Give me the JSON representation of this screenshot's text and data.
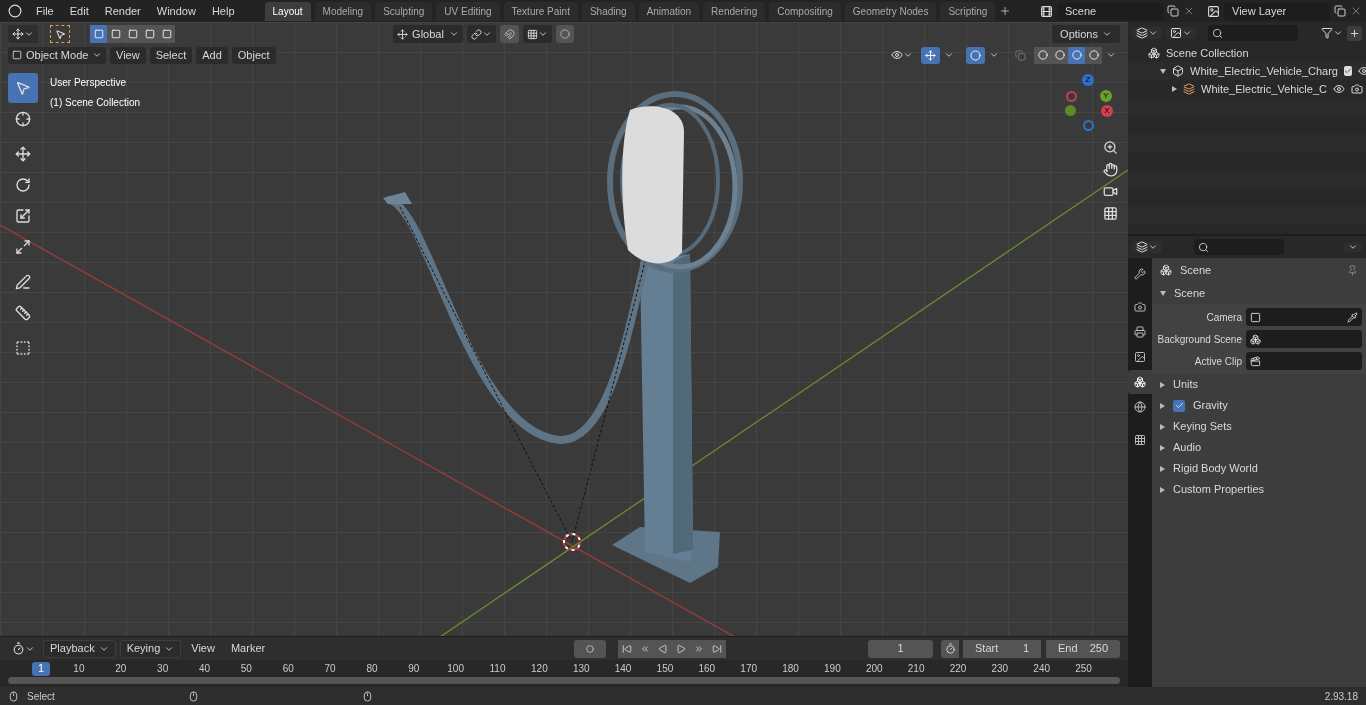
{
  "menu_bar": {
    "menus": [
      "File",
      "Edit",
      "Render",
      "Window",
      "Help"
    ],
    "workspaces": [
      {
        "label": "Layout",
        "selected": true
      },
      {
        "label": "Modeling",
        "selected": false
      },
      {
        "label": "Sculpting",
        "selected": false
      },
      {
        "label": "UV Editing",
        "selected": false
      },
      {
        "label": "Texture Paint",
        "selected": false
      },
      {
        "label": "Shading",
        "selected": false
      },
      {
        "label": "Animation",
        "selected": false
      },
      {
        "label": "Rendering",
        "selected": false
      },
      {
        "label": "Compositing",
        "selected": false
      },
      {
        "label": "Geometry Nodes",
        "selected": false
      },
      {
        "label": "Scripting",
        "selected": false
      }
    ],
    "scene": "Scene",
    "view_layer": "View Layer"
  },
  "viewport": {
    "select_modes": [
      {
        "selected": true
      },
      {
        "selected": false
      },
      {
        "selected": false
      },
      {
        "selected": false
      },
      {
        "selected": false
      }
    ],
    "orientation": "Global",
    "options": "Options",
    "mode": "Object Mode",
    "menus": [
      "View",
      "Select",
      "Add",
      "Object"
    ],
    "shading": [
      {
        "selected": false
      },
      {
        "selected": false
      },
      {
        "selected": true
      },
      {
        "selected": false
      }
    ],
    "overlay_text": [
      "User Perspective",
      "(1) Scene Collection"
    ],
    "tools": [
      {
        "selected": true
      },
      {
        "selected": false
      },
      {
        "selected": false
      },
      {
        "selected": false
      },
      {
        "selected": false
      },
      {
        "selected": false
      },
      {
        "selected": false
      },
      {
        "selected": false
      },
      {
        "selected": false
      }
    ],
    "gizmo_axes": [
      "Z",
      "Y",
      "X"
    ]
  },
  "outliner": {
    "items": [
      {
        "label": "Scene Collection",
        "kind": "scene",
        "children": [
          {
            "label": "White_Electric_Vehicle_Charg",
            "kind": "collection",
            "expanded": true,
            "checked": true,
            "children": [
              {
                "label": "White_Electric_Vehicle_C",
                "kind": "empty",
                "expanded": false
              }
            ]
          }
        ]
      }
    ]
  },
  "properties": {
    "tabs": [
      {
        "selected": false
      },
      {
        "selected": false
      },
      {
        "selected": false
      },
      {
        "selected": false
      },
      {
        "selected": true
      },
      {
        "selected": false
      },
      {
        "selected": false
      }
    ],
    "context": "Scene",
    "panel": {
      "title": "Scene",
      "expanded": true,
      "fields": [
        {
          "label": "Camera",
          "kind": "camera"
        },
        {
          "label": "Background Scene",
          "kind": "scene"
        },
        {
          "label": "Active Clip",
          "kind": "clip"
        }
      ]
    },
    "sections": [
      {
        "label": "Units",
        "expanded": false
      },
      {
        "label": "Gravity",
        "expanded": false,
        "checked": true
      },
      {
        "label": "Keying Sets",
        "expanded": false
      },
      {
        "label": "Audio",
        "expanded": false
      },
      {
        "label": "Rigid Body World",
        "expanded": false
      },
      {
        "label": "Custom Properties",
        "expanded": false
      }
    ]
  },
  "timeline": {
    "menus": [
      "Playback",
      "Keying",
      "View",
      "Marker"
    ],
    "current_frame": "1",
    "start_label": "Start",
    "start": "1",
    "end_label": "End",
    "end": "250",
    "playhead": "1",
    "ticks": [
      "10",
      "20",
      "30",
      "40",
      "50",
      "60",
      "70",
      "80",
      "90",
      "100",
      "110",
      "120",
      "130",
      "140",
      "150",
      "160",
      "170",
      "180",
      "190",
      "200",
      "210",
      "220",
      "230",
      "240",
      "250"
    ]
  },
  "status_bar": {
    "hint": "Select",
    "version": "2.93.18"
  }
}
